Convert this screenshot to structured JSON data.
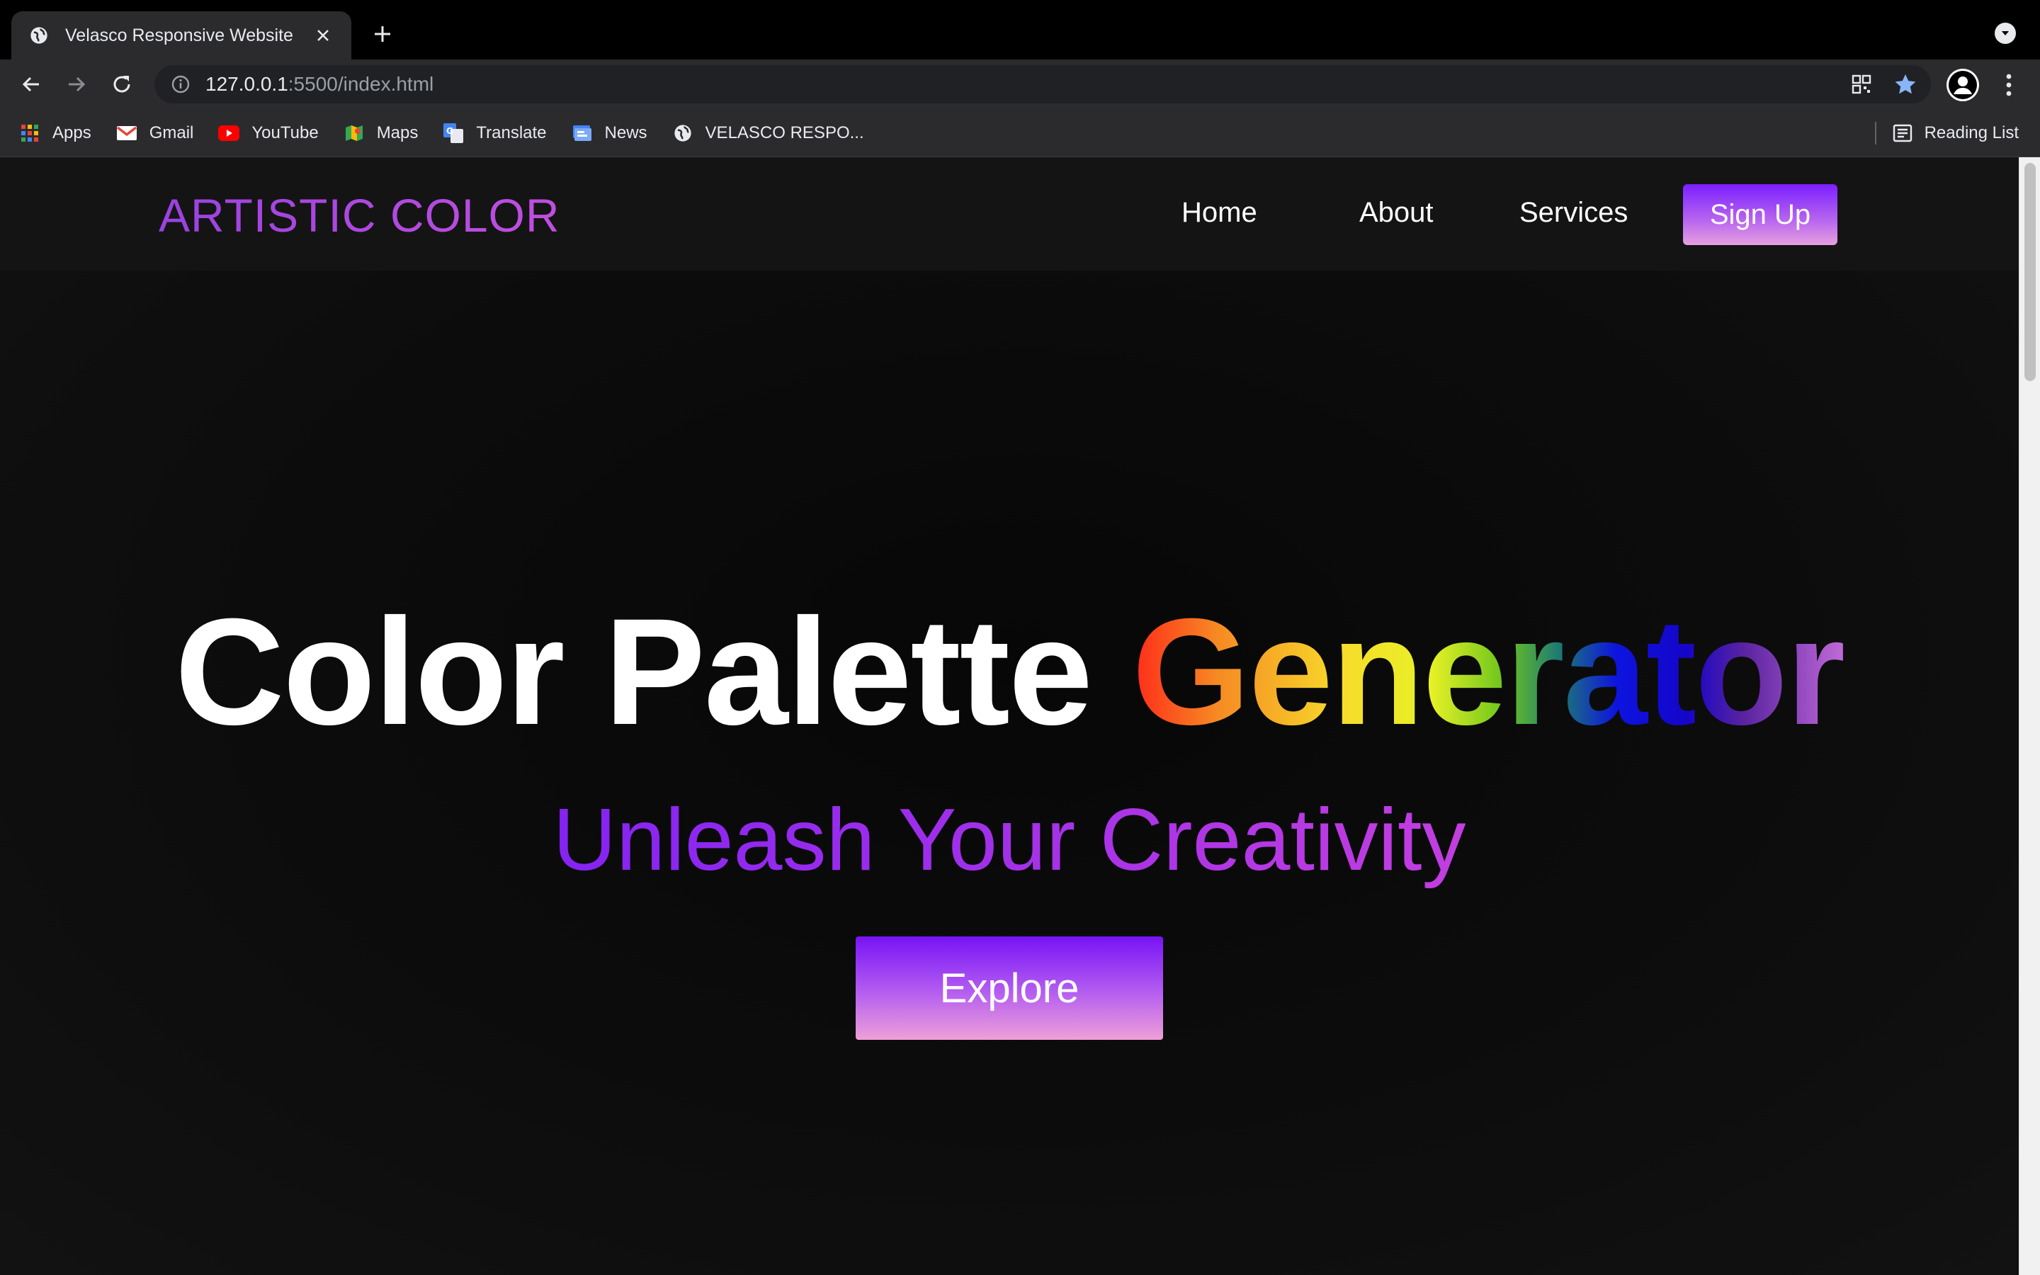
{
  "browser": {
    "tab": {
      "title": "Velasco Responsive Website"
    },
    "address": {
      "host": "127.0.0.1",
      "path": ":5500/index.html"
    },
    "bookmarks": [
      {
        "label": "Apps",
        "icon": "apps-grid-icon"
      },
      {
        "label": "Gmail",
        "icon": "gmail-icon"
      },
      {
        "label": "YouTube",
        "icon": "youtube-icon"
      },
      {
        "label": "Maps",
        "icon": "maps-icon"
      },
      {
        "label": "Translate",
        "icon": "translate-icon"
      },
      {
        "label": "News",
        "icon": "news-icon"
      },
      {
        "label": "VELASCO RESPO...",
        "icon": "globe-icon"
      }
    ],
    "reading_list": "Reading List"
  },
  "site": {
    "logo": "ARTISTIC COLOR",
    "nav": {
      "home": "Home",
      "about": "About",
      "services": "Services",
      "signup": "Sign Up"
    },
    "hero": {
      "title_plain": "Color Palette ",
      "title_rainbow": "Generator",
      "subtitle": "Unleash Your Creativity",
      "cta": "Explore"
    },
    "colors": {
      "logo": "#b148e6",
      "accent_purple": "#7a1fff",
      "accent_pink": "#ef9fd8"
    }
  }
}
